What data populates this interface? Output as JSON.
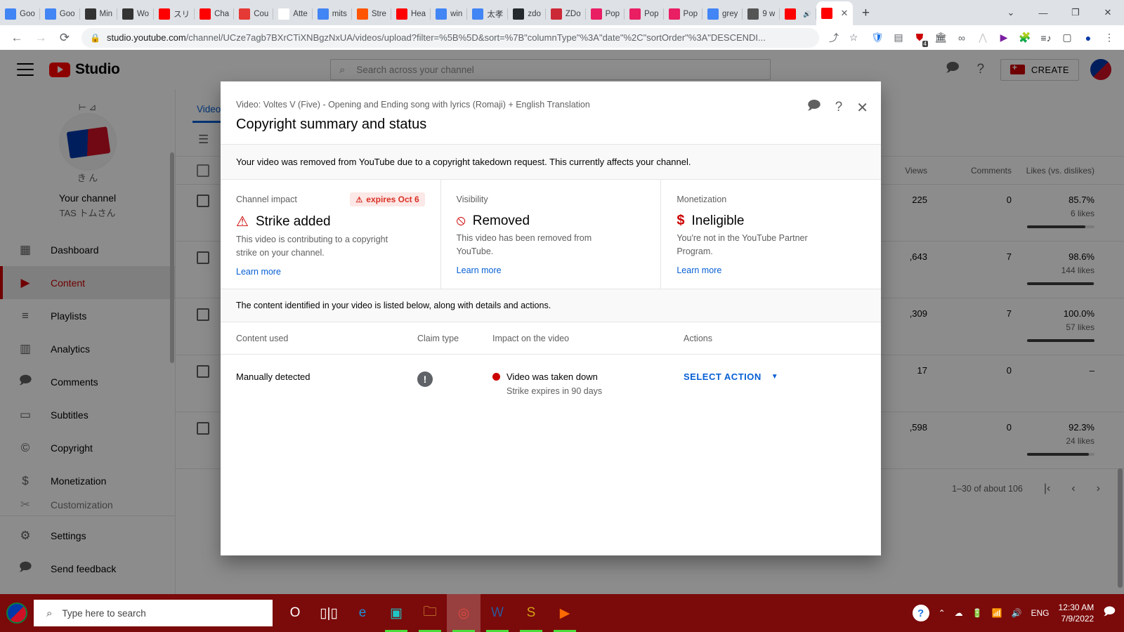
{
  "browser": {
    "tabs": [
      {
        "label": "Goo",
        "icon": "google-docs-icon",
        "color": "#4285f4"
      },
      {
        "label": "Goo",
        "icon": "google-docs-icon",
        "color": "#4285f4"
      },
      {
        "label": "Min",
        "icon": "bank-icon",
        "color": "#333333"
      },
      {
        "label": "Wo",
        "icon": "bank-icon",
        "color": "#333333"
      },
      {
        "label": "スリ",
        "icon": "youtube-icon",
        "color": "#ff0000"
      },
      {
        "label": "Cha",
        "icon": "youtube-icon",
        "color": "#ff0000"
      },
      {
        "label": "Cou",
        "icon": "eco-icon",
        "color": "#e53935"
      },
      {
        "label": "Atte",
        "icon": "blank-icon",
        "color": "#ffffff"
      },
      {
        "label": "mits",
        "icon": "google-icon",
        "color": "#4285f4"
      },
      {
        "label": "Stre",
        "icon": "soundcloud-icon",
        "color": "#ff5500"
      },
      {
        "label": "Hea",
        "icon": "youtube-icon",
        "color": "#ff0000"
      },
      {
        "label": "win",
        "icon": "google-icon",
        "color": "#4285f4"
      },
      {
        "label": "太孝",
        "icon": "google-icon",
        "color": "#4285f4"
      },
      {
        "label": "zdo",
        "icon": "github-icon",
        "color": "#24292e"
      },
      {
        "label": "ZDo",
        "icon": "zotero-icon",
        "color": "#cc2936"
      },
      {
        "label": "Pop",
        "icon": "heart-icon",
        "color": "#e91e63"
      },
      {
        "label": "Pop",
        "icon": "heart-icon",
        "color": "#e91e63"
      },
      {
        "label": "Pop",
        "icon": "heart-icon",
        "color": "#e91e63"
      },
      {
        "label": "grey",
        "icon": "google-icon",
        "color": "#4285f4"
      },
      {
        "label": "9 w",
        "icon": "calculator-icon",
        "color": "#555555"
      },
      {
        "label": "",
        "icon": "youtube-icon",
        "color": "#ff0000",
        "muted": true
      },
      {
        "label": "",
        "icon": "youtube-icon",
        "color": "#ff0000",
        "active": true
      }
    ],
    "new_tab_label": "+",
    "window_controls": {
      "list": "⌄",
      "minimize": "—",
      "maximize": "❐",
      "close": "✕"
    },
    "nav": {
      "back": "←",
      "forward": "→",
      "reload": "⟳"
    },
    "url_host": "studio.youtube.com",
    "url_path": "/channel/UCze7agb7BXrCTiXNBgzNxUA/videos/upload?filter=%5B%5D&sort=%7B\"columnType\"%3A\"date\"%2C\"sortOrder\"%3A\"DESCENDI...",
    "lock_icon": "lock-icon",
    "share_icon": "share-icon",
    "bookmark_icon": "star-icon",
    "extensions": [
      {
        "name": "shield-extension-icon",
        "glyph": "🛡",
        "color": "#1a73e8"
      },
      {
        "name": "copy-extension-icon",
        "glyph": "▤",
        "color": "#5f6368"
      },
      {
        "name": "ublock-extension-icon",
        "glyph": "⛊",
        "color": "#cc0000",
        "badge": "4"
      },
      {
        "name": "bank-extension-icon",
        "glyph": "🏛",
        "color": "#3c4043"
      },
      {
        "name": "link-extension-icon",
        "glyph": "∞",
        "color": "#5f6368"
      },
      {
        "name": "mountain-extension-icon",
        "glyph": "⋀",
        "color": "#c9c9c9"
      },
      {
        "name": "media-player-extension-icon",
        "glyph": "▶",
        "color": "#7b1fa2"
      },
      {
        "name": "puzzle-extensions-icon",
        "glyph": "🧩",
        "color": "#5f6368"
      },
      {
        "name": "playlist-extension-icon",
        "glyph": "≡♪",
        "color": "#3c4043"
      },
      {
        "name": "sidepanel-icon",
        "glyph": "▢",
        "color": "#3c4043"
      },
      {
        "name": "profile-avatar-icon",
        "glyph": "●",
        "color": "#0038a8"
      },
      {
        "name": "chrome-menu-icon",
        "glyph": "⋮",
        "color": "#3c4043"
      }
    ]
  },
  "studio": {
    "logo_text": "Studio",
    "search_placeholder": "Search across your channel",
    "search_icon": "search-icon",
    "menu_icon": "hamburger-icon",
    "feedback_icon": "feedback-icon",
    "help_icon": "help-icon",
    "create_label": "CREATE",
    "create_icon": "video-camera-plus-icon",
    "avatar_icon": "channel-avatar"
  },
  "sidebar": {
    "channel_label": "Your channel",
    "channel_name": "TAS トムさん",
    "deco_top": "⊢ ⊿",
    "deco_bottom": "き ん",
    "items": [
      {
        "label": "Dashboard",
        "icon": "dashboard-icon",
        "active": false
      },
      {
        "label": "Content",
        "icon": "content-video-icon",
        "active": true
      },
      {
        "label": "Playlists",
        "icon": "playlists-icon",
        "active": false
      },
      {
        "label": "Analytics",
        "icon": "analytics-icon",
        "active": false
      },
      {
        "label": "Comments",
        "icon": "comments-icon",
        "active": false
      },
      {
        "label": "Subtitles",
        "icon": "subtitles-icon",
        "active": false
      },
      {
        "label": "Copyright",
        "icon": "copyright-icon",
        "active": false
      },
      {
        "label": "Monetization",
        "icon": "monetization-icon",
        "active": false
      },
      {
        "label": "Customization",
        "icon": "customization-icon",
        "active": false
      }
    ],
    "footer_items": [
      {
        "label": "Settings",
        "icon": "gear-icon"
      },
      {
        "label": "Send feedback",
        "icon": "send-feedback-icon"
      }
    ]
  },
  "content": {
    "tab_label": "Videos",
    "filter_icon": "filter-icon",
    "columns": {
      "views": "Views",
      "comments": "Comments",
      "likes": "Likes (vs. dislikes)"
    },
    "rows": [
      {
        "views": "225",
        "comments": "0",
        "likes_pct": "85.7%",
        "likes_count": "6 likes",
        "bar": 86
      },
      {
        "views": ",643",
        "comments": "7",
        "likes_pct": "98.6%",
        "likes_count": "144 likes",
        "bar": 99
      },
      {
        "views": ",309",
        "comments": "7",
        "likes_pct": "100.0%",
        "likes_count": "57 likes",
        "bar": 100
      },
      {
        "views": "17",
        "comments": "0",
        "likes_pct": "–",
        "likes_count": "",
        "bar": 0
      },
      {
        "views": ",598",
        "comments": "0",
        "likes_pct": "92.3%",
        "likes_count": "24 likes",
        "bar": 92
      }
    ],
    "pager_text": "1–30 of about 106",
    "pager_first": "|‹",
    "pager_prev": "‹",
    "pager_next": "›"
  },
  "dialog": {
    "subtitle": "Video: Voltes V (Five) - Opening and Ending song with lyrics (Romaji) + English Translation",
    "title": "Copyright summary and status",
    "report_icon": "report-flag-icon",
    "help_icon": "help-circle-icon",
    "close_icon": "close-icon",
    "banner": "Your video was removed from YouTube due to a copyright takedown request. This currently affects your channel.",
    "cards": [
      {
        "label": "Channel impact",
        "badge": "expires Oct 6",
        "badge_icon": "warning-triangle-icon",
        "status_icon": "warning-triangle-icon",
        "status": "Strike added",
        "desc": "This video is contributing to a copyright strike on your channel.",
        "link": "Learn more"
      },
      {
        "label": "Visibility",
        "badge": "",
        "status_icon": "eye-off-icon",
        "status": "Removed",
        "desc": "This video has been removed from YouTube.",
        "link": "Learn more"
      },
      {
        "label": "Monetization",
        "badge": "",
        "status_icon": "dollar-strikethrough-icon",
        "status": "Ineligible",
        "desc": "You're not in the YouTube Partner Program.",
        "link": "Learn more"
      }
    ],
    "note": "The content identified in your video is listed below, along with details and actions.",
    "table_headers": {
      "content_used": "Content used",
      "claim_type": "Claim type",
      "impact": "Impact on the video",
      "actions": "Actions"
    },
    "row": {
      "content_used": "Manually detected",
      "claim_type_icon": "info-exclamation-icon",
      "impact_main": "Video was taken down",
      "impact_sub": "Strike expires in 90 days",
      "action_label": "SELECT ACTION",
      "action_caret": "▼"
    },
    "colors": {
      "strike_red": "#cc0000",
      "badge_bg": "#fce8e6",
      "badge_fg": "#d93025",
      "link_blue": "#065fd4"
    }
  },
  "taskbar": {
    "search_placeholder": "Type here to search",
    "search_icon": "search-icon",
    "start_icon": "windows-start-icon",
    "apps": [
      {
        "name": "cortana-icon",
        "glyph": "O"
      },
      {
        "name": "task-view-icon",
        "glyph": "▯|▯"
      },
      {
        "name": "microsoft-edge-icon",
        "glyph": "e"
      },
      {
        "name": "media-app-icon",
        "glyph": "▣"
      },
      {
        "name": "file-explorer-icon",
        "glyph": "🗀"
      },
      {
        "name": "google-chrome-icon",
        "glyph": "◎"
      },
      {
        "name": "microsoft-word-icon",
        "glyph": "W"
      },
      {
        "name": "sketchup-icon",
        "glyph": "S"
      },
      {
        "name": "video-player-icon",
        "glyph": "▶"
      }
    ],
    "tray": {
      "help_icon": "help-question-icon",
      "chevron_icon": "show-hidden-icons-icon",
      "cloud_icon": "onedrive-paused-icon",
      "battery_icon": "battery-charging-icon",
      "wifi_icon": "wifi-icon",
      "volume_icon": "speaker-icon",
      "language": "ENG",
      "time": "12:30 AM",
      "date": "7/9/2022",
      "notification_icon": "action-center-icon"
    }
  }
}
